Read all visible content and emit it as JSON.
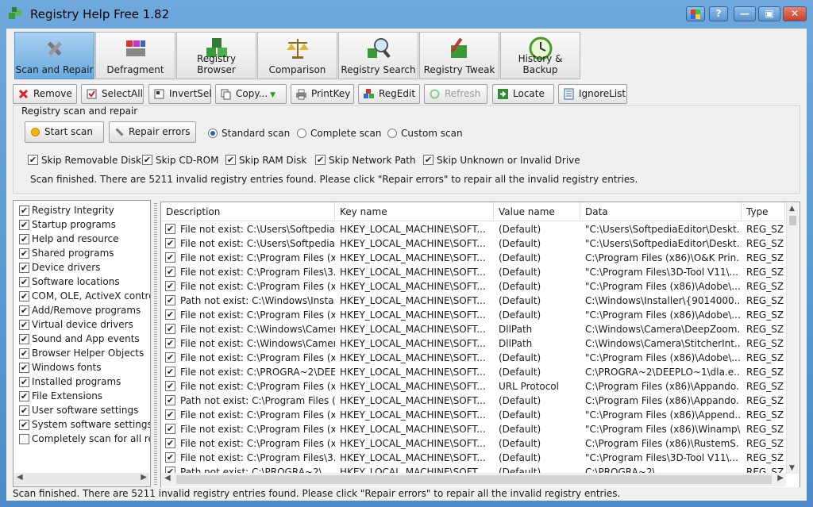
{
  "app": {
    "title": "Registry Help Free 1.82"
  },
  "tabs": [
    {
      "label": "Scan and Repair",
      "icon": "tools-icon"
    },
    {
      "label": "Defragment",
      "icon": "defrag-icon"
    },
    {
      "label": "Registry Browser",
      "icon": "cubes-icon"
    },
    {
      "label": "Comparison",
      "icon": "scale-icon"
    },
    {
      "label": "Registry Search",
      "icon": "magnifier-icon"
    },
    {
      "label": "Registry Tweak",
      "icon": "tweak-icon"
    },
    {
      "label": "History & Backup",
      "icon": "clock-icon"
    }
  ],
  "toolbar": {
    "remove": "Remove",
    "selectall": "SelectAll",
    "invertsel": "InvertSel",
    "copy": "Copy...",
    "printkey": "PrintKey",
    "regedit": "RegEdit",
    "refresh": "Refresh",
    "locate": "Locate",
    "ignorelist": "IgnoreList"
  },
  "scan_panel": {
    "title": "Registry scan and repair",
    "start_scan": "Start scan",
    "repair_errors": "Repair errors",
    "radios": [
      "Standard scan",
      "Complete scan",
      "Custom scan"
    ],
    "radio_selected": 0,
    "skips": [
      "Skip Removable Disk",
      "Skip CD-ROM",
      "Skip RAM Disk",
      "Skip Network Path",
      "Skip Unknown or Invalid Drive"
    ],
    "status": "Scan finished. There are 5211 invalid registry entries found. Please click \"Repair errors\" to repair all the invalid registry entries."
  },
  "categories": [
    {
      "label": "Registry Integrity",
      "checked": true
    },
    {
      "label": "Startup programs",
      "checked": true
    },
    {
      "label": "Help and resource",
      "checked": true
    },
    {
      "label": "Shared programs",
      "checked": true
    },
    {
      "label": "Device drivers",
      "checked": true
    },
    {
      "label": "Software locations",
      "checked": true
    },
    {
      "label": "COM, OLE, ActiveX control",
      "checked": true
    },
    {
      "label": "Add/Remove programs",
      "checked": true
    },
    {
      "label": "Virtual device drivers",
      "checked": true
    },
    {
      "label": "Sound and App events",
      "checked": true
    },
    {
      "label": "Browser Helper Objects",
      "checked": true
    },
    {
      "label": "Windows fonts",
      "checked": true
    },
    {
      "label": "Installed programs",
      "checked": true
    },
    {
      "label": "File Extensions",
      "checked": true
    },
    {
      "label": "User software settings",
      "checked": true
    },
    {
      "label": "System software settings",
      "checked": true
    },
    {
      "label": "Completely scan for all regi",
      "checked": false
    }
  ],
  "table": {
    "columns": [
      "Description",
      "Key name",
      "Value name",
      "Data",
      "Type"
    ],
    "rows": [
      [
        "File not exist: C:\\Users\\Softpedia...",
        "HKEY_LOCAL_MACHINE\\SOFT...",
        "(Default)",
        "\"C:\\Users\\SoftpediaEditor\\Deskt...",
        "REG_SZ"
      ],
      [
        "File not exist: C:\\Users\\Softpedia...",
        "HKEY_LOCAL_MACHINE\\SOFT...",
        "(Default)",
        "\"C:\\Users\\SoftpediaEditor\\Deskt...",
        "REG_SZ"
      ],
      [
        "File not exist: C:\\Program Files (x...",
        "HKEY_LOCAL_MACHINE\\SOFT...",
        "(Default)",
        "C:\\Program Files (x86)\\O&K Prin...",
        "REG_SZ"
      ],
      [
        "File not exist: C:\\Program Files\\3...",
        "HKEY_LOCAL_MACHINE\\SOFT...",
        "(Default)",
        "\"C:\\Program Files\\3D-Tool V11\\...",
        "REG_SZ"
      ],
      [
        "File not exist: C:\\Program Files (x...",
        "HKEY_LOCAL_MACHINE\\SOFT...",
        "(Default)",
        "\"C:\\Program Files (x86)\\Adobe\\...",
        "REG_SZ"
      ],
      [
        "Path not exist: C:\\Windows\\Insta...",
        "HKEY_LOCAL_MACHINE\\SOFT...",
        "(Default)",
        "C:\\Windows\\Installer\\{9014000...",
        "REG_SZ"
      ],
      [
        "File not exist: C:\\Program Files (x...",
        "HKEY_LOCAL_MACHINE\\SOFT...",
        "(Default)",
        "\"C:\\Program Files (x86)\\Adobe\\...",
        "REG_SZ"
      ],
      [
        "File not exist: C:\\Windows\\Camer...",
        "HKEY_LOCAL_MACHINE\\SOFT...",
        "DllPath",
        "C:\\Windows\\Camera\\DeepZoom...",
        "REG_SZ"
      ],
      [
        "File not exist: C:\\Windows\\Camer...",
        "HKEY_LOCAL_MACHINE\\SOFT...",
        "DllPath",
        "C:\\Windows\\Camera\\StitcherInt...",
        "REG_SZ"
      ],
      [
        "File not exist: C:\\Program Files (x...",
        "HKEY_LOCAL_MACHINE\\SOFT...",
        "(Default)",
        "\"C:\\Program Files (x86)\\Adobe\\...",
        "REG_SZ"
      ],
      [
        "File not exist: C:\\PROGRA~2\\DEE...",
        "HKEY_LOCAL_MACHINE\\SOFT...",
        "(Default)",
        "C:\\PROGRA~2\\DEEPLO~1\\dla.e...",
        "REG_SZ"
      ],
      [
        "File not exist: C:\\Program Files (x...",
        "HKEY_LOCAL_MACHINE\\SOFT...",
        "URL Protocol",
        "C:\\Program Files (x86)\\Appando...",
        "REG_SZ"
      ],
      [
        "Path not exist: C:\\Program Files (...",
        "HKEY_LOCAL_MACHINE\\SOFT...",
        "(Default)",
        "C:\\Program Files (x86)\\Appando...",
        "REG_SZ"
      ],
      [
        "File not exist: C:\\Program Files (x...",
        "HKEY_LOCAL_MACHINE\\SOFT...",
        "(Default)",
        "\"C:\\Program Files (x86)\\Append...",
        "REG_SZ"
      ],
      [
        "File not exist: C:\\Program Files (x...",
        "HKEY_LOCAL_MACHINE\\SOFT...",
        "(Default)",
        "\"C:\\Program Files (x86)\\Winamp\\...",
        "REG_SZ"
      ],
      [
        "File not exist: C:\\Program Files (x...",
        "HKEY_LOCAL_MACHINE\\SOFT...",
        "(Default)",
        "C:\\Program Files (x86)\\RustemS...",
        "REG_SZ"
      ],
      [
        "File not exist: C:\\Program Files\\3...",
        "HKEY_LOCAL_MACHINE\\SOFT...",
        "(Default)",
        "\"C:\\Program Files\\3D-Tool V11\\...",
        "REG_SZ"
      ],
      [
        "Path not exist: C:\\PROGRA~2\\...",
        "HKEY_LOCAL_MACHINE\\SOFT...",
        "(Default)",
        "C:\\PROGRA~2\\...",
        "REG_SZ"
      ]
    ]
  },
  "statusbar": "Scan finished. There are 5211 invalid registry entries found. Please click \"Repair errors\" to repair all the invalid registry entries."
}
